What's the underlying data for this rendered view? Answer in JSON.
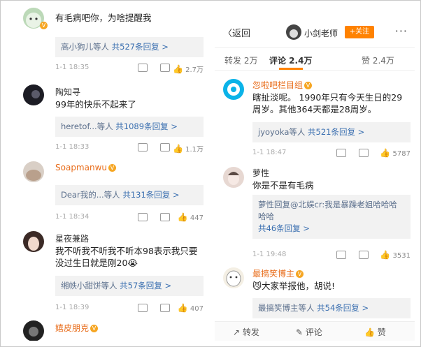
{
  "left_panel": {
    "comments": [
      {
        "username": "",
        "text": "有毛病吧你，为啥提醒我",
        "reply": {
          "users": "高小狗儿等人",
          "count": "共527条回复 >"
        },
        "time": "1-1 18:35",
        "likes": "2.7万"
      },
      {
        "username": "陶知寻",
        "text": "99年的快乐不起来了",
        "reply": {
          "users": "heretof...等人",
          "count": "共1089条回复 >"
        },
        "time": "1-1 18:33",
        "likes": "1.1万"
      },
      {
        "username": "Soapmanwu",
        "text": "",
        "reply": {
          "users": "Dear我的...等人",
          "count": "共131条回复 >"
        },
        "time": "1-1 18:34",
        "likes": "447"
      },
      {
        "username": "星夜兼路",
        "text": "我不听我不听我不听本98表示我只要没过生日就是刚20😭",
        "reply": {
          "users": "缃帙小甜饼等人",
          "count": "共57条回复 >"
        },
        "time": "1-1 18:39",
        "likes": "407"
      },
      {
        "username": "嬉皮朋克",
        "text": "",
        "reply": null,
        "time": "",
        "likes": ""
      }
    ]
  },
  "right_panel": {
    "header": {
      "back_label": "〈返回",
      "author_name": "小剑老师",
      "follow_label": "+关注",
      "more_label": "···"
    },
    "tabs": [
      {
        "label": "转发 2万",
        "active": false
      },
      {
        "label": "评论 2.4万",
        "active": true
      },
      {
        "label": "赞 2.4万",
        "active": false
      }
    ],
    "comments": [
      {
        "username": "忽啦吧栏目组",
        "text": "瞎扯淡呢。 1990年只有今天生日的29周岁。其他364天都是28周岁。",
        "reply": {
          "users": "jyoyoka等人",
          "count": "共521条回复 >"
        },
        "time": "1-1 18:47",
        "likes": "5787"
      },
      {
        "username": "萝性",
        "text": "你是不是有毛病",
        "reply": {
          "users": "萝性回复@北娱cr:我是暴躁老姐哈哈哈哈哈",
          "count": "共46条回复 >"
        },
        "time": "1-1 19:48",
        "likes": "3531"
      },
      {
        "username": "最搞笑博主",
        "text": "😼大家举报他，胡说!",
        "reply": {
          "users": "最搞笑博主等人",
          "count": "共54条回复 >"
        },
        "time": "",
        "likes": ""
      }
    ],
    "bottombar": {
      "forward": "转发",
      "comment": "评论",
      "like": "赞"
    }
  },
  "colors": {
    "accent_orange": "#ff8200",
    "vip_name": "#e86c1a",
    "link_blue": "#3a6fb0",
    "reply_bg": "#f2f2f2"
  }
}
